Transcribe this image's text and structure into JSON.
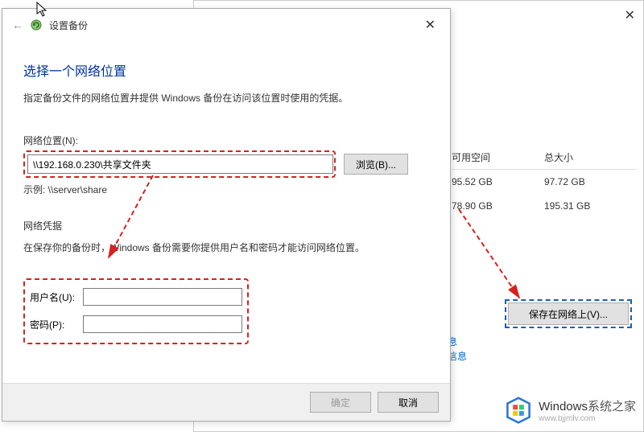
{
  "dialog": {
    "title": "设置备份",
    "heading": "选择一个网络位置",
    "description": "指定备份文件的网络位置并提供 Windows 备份在访问该位置时使用的凭据。",
    "network_location_label": "网络位置(N):",
    "network_location_value": "\\\\192.168.0.230\\共享文件夹",
    "browse_label": "浏览(B)...",
    "example_text": "示例: \\\\server\\share",
    "cred_heading": "网络凭据",
    "cred_description": "在保存你的备份时，Windows 备份需要你提供用户名和密码才能访问网络位置。",
    "username_label": "用户名(U):",
    "username_value": "",
    "password_label": "密码(P):",
    "password_value": "",
    "ok_label": "确定",
    "cancel_label": "取消"
  },
  "parent": {
    "col_free": "可用空间",
    "col_total": "总大小",
    "rows": [
      {
        "free": "95.52 GB",
        "total": "97.72 GB"
      },
      {
        "free": "78.90 GB",
        "total": "195.31 GB"
      }
    ],
    "save_network_label": "保存在网络上(V)...",
    "link1": "息",
    "link2": "信息"
  },
  "watermark": {
    "brand": "Windows",
    "tagline": "系统之家",
    "url": "www.bjjmlv.com"
  }
}
